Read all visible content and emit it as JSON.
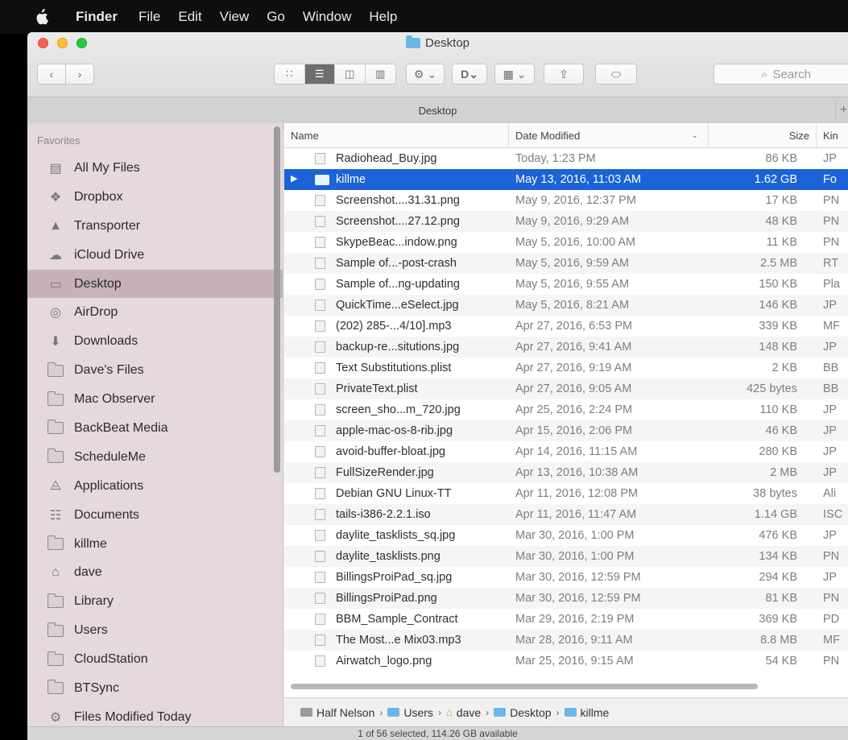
{
  "menubar": {
    "apple_icon": "apple-logo",
    "app": "Finder",
    "items": [
      "File",
      "Edit",
      "View",
      "Go",
      "Window",
      "Help"
    ]
  },
  "window": {
    "title": "Desktop",
    "tab_title": "Desktop",
    "search_placeholder": "Search"
  },
  "sidebar": {
    "section": "Favorites",
    "items": [
      {
        "label": "All My Files",
        "icon": "all-files-icon"
      },
      {
        "label": "Dropbox",
        "icon": "dropbox-icon"
      },
      {
        "label": "Transporter",
        "icon": "transporter-icon"
      },
      {
        "label": "iCloud Drive",
        "icon": "cloud-icon"
      },
      {
        "label": "Desktop",
        "icon": "desktop-icon",
        "selected": true
      },
      {
        "label": "AirDrop",
        "icon": "airdrop-icon"
      },
      {
        "label": "Downloads",
        "icon": "downloads-icon"
      },
      {
        "label": "Dave's Files",
        "icon": "folder-icon"
      },
      {
        "label": "Mac Observer",
        "icon": "folder-icon"
      },
      {
        "label": "BackBeat Media",
        "icon": "folder-icon"
      },
      {
        "label": "ScheduleMe",
        "icon": "folder-icon"
      },
      {
        "label": "Applications",
        "icon": "applications-icon"
      },
      {
        "label": "Documents",
        "icon": "documents-icon"
      },
      {
        "label": "killme",
        "icon": "folder-icon"
      },
      {
        "label": "dave",
        "icon": "home-icon"
      },
      {
        "label": "Library",
        "icon": "folder-icon"
      },
      {
        "label": "Users",
        "icon": "folder-icon"
      },
      {
        "label": "CloudStation",
        "icon": "folder-icon"
      },
      {
        "label": "BTSync",
        "icon": "folder-icon"
      },
      {
        "label": "Files Modified Today",
        "icon": "gear-icon"
      }
    ]
  },
  "columns": {
    "name": "Name",
    "date": "Date Modified",
    "size": "Size",
    "kind": "Kin"
  },
  "files": [
    {
      "name": "Radiohead_Buy.jpg",
      "date": "Today, 1:23 PM",
      "size": "86 KB",
      "kind": "JP"
    },
    {
      "name": "killme",
      "date": "May 13, 2016, 11:03 AM",
      "size": "1.62 GB",
      "kind": "Fo",
      "folder": true,
      "selected": true
    },
    {
      "name": "Screenshot....31.31.png",
      "date": "May 9, 2016, 12:37 PM",
      "size": "17 KB",
      "kind": "PN"
    },
    {
      "name": "Screenshot....27.12.png",
      "date": "May 9, 2016, 9:29 AM",
      "size": "48 KB",
      "kind": "PN"
    },
    {
      "name": "SkypeBeac...indow.png",
      "date": "May 5, 2016, 10:00 AM",
      "size": "11 KB",
      "kind": "PN"
    },
    {
      "name": "Sample of...-post-crash",
      "date": "May 5, 2016, 9:59 AM",
      "size": "2.5 MB",
      "kind": "RT"
    },
    {
      "name": "Sample of...ng-updating",
      "date": "May 5, 2016, 9:55 AM",
      "size": "150 KB",
      "kind": "Pla"
    },
    {
      "name": "QuickTime...eSelect.jpg",
      "date": "May 5, 2016, 8:21 AM",
      "size": "146 KB",
      "kind": "JP"
    },
    {
      "name": "(202) 285-...4/10].mp3",
      "date": "Apr 27, 2016, 6:53 PM",
      "size": "339 KB",
      "kind": "MF"
    },
    {
      "name": "backup-re...situtions.jpg",
      "date": "Apr 27, 2016, 9:41 AM",
      "size": "148 KB",
      "kind": "JP"
    },
    {
      "name": "Text Substitutions.plist",
      "date": "Apr 27, 2016, 9:19 AM",
      "size": "2 KB",
      "kind": "BB"
    },
    {
      "name": "PrivateText.plist",
      "date": "Apr 27, 2016, 9:05 AM",
      "size": "425 bytes",
      "kind": "BB"
    },
    {
      "name": "screen_sho...m_720.jpg",
      "date": "Apr 25, 2016, 2:24 PM",
      "size": "110 KB",
      "kind": "JP"
    },
    {
      "name": "apple-mac-os-8-rib.jpg",
      "date": "Apr 15, 2016, 2:06 PM",
      "size": "46 KB",
      "kind": "JP"
    },
    {
      "name": "avoid-buffer-bloat.jpg",
      "date": "Apr 14, 2016, 11:15 AM",
      "size": "280 KB",
      "kind": "JP"
    },
    {
      "name": "FullSizeRender.jpg",
      "date": "Apr 13, 2016, 10:38 AM",
      "size": "2 MB",
      "kind": "JP"
    },
    {
      "name": "Debian GNU Linux-TT",
      "date": "Apr 11, 2016, 12:08 PM",
      "size": "38 bytes",
      "kind": "Ali"
    },
    {
      "name": "tails-i386-2.2.1.iso",
      "date": "Apr 11, 2016, 11:47 AM",
      "size": "1.14 GB",
      "kind": "ISC"
    },
    {
      "name": "daylite_tasklists_sq.jpg",
      "date": "Mar 30, 2016, 1:00 PM",
      "size": "476 KB",
      "kind": "JP"
    },
    {
      "name": "daylite_tasklists.png",
      "date": "Mar 30, 2016, 1:00 PM",
      "size": "134 KB",
      "kind": "PN"
    },
    {
      "name": "BillingsProiPad_sq.jpg",
      "date": "Mar 30, 2016, 12:59 PM",
      "size": "294 KB",
      "kind": "JP"
    },
    {
      "name": "BillingsProiPad.png",
      "date": "Mar 30, 2016, 12:59 PM",
      "size": "81 KB",
      "kind": "PN"
    },
    {
      "name": "BBM_Sample_Contract",
      "date": "Mar 29, 2016, 2:19 PM",
      "size": "369 KB",
      "kind": "PD"
    },
    {
      "name": "The Most...e Mix03.mp3",
      "date": "Mar 28, 2016, 9:11 AM",
      "size": "8.8 MB",
      "kind": "MF"
    },
    {
      "name": "Airwatch_logo.png",
      "date": "Mar 25, 2016, 9:15 AM",
      "size": "54 KB",
      "kind": "PN"
    }
  ],
  "pathbar": [
    "Half Nelson",
    "Users",
    "dave",
    "Desktop",
    "killme"
  ],
  "status": "1 of 56 selected, 114.26 GB available"
}
